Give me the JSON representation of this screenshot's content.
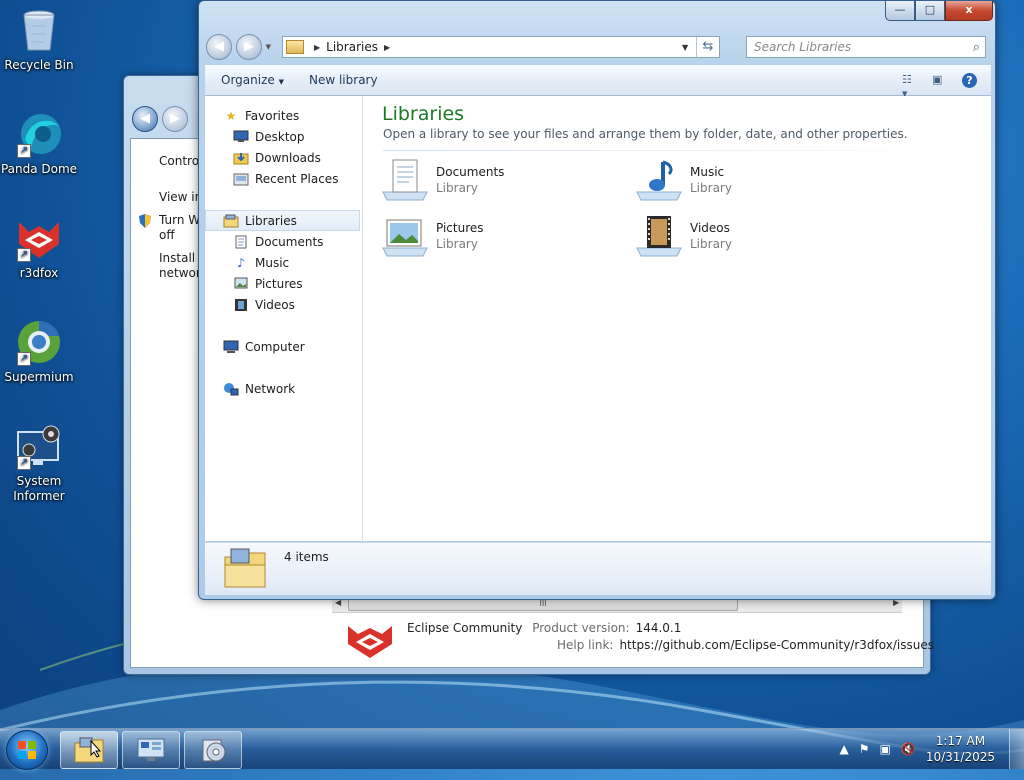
{
  "desktop": {
    "icons": [
      {
        "label": "Recycle Bin"
      },
      {
        "label": "Panda Dome"
      },
      {
        "label": "r3dfox"
      },
      {
        "label": "Supermium"
      },
      {
        "label": "System Informer"
      }
    ]
  },
  "back_window": {
    "partial_texts": [
      "Contro",
      "View in",
      "Turn W",
      "off",
      "Install a",
      "networ"
    ],
    "app_name": "Eclipse Community",
    "product_version_label": "Product version:",
    "product_version": "144.0.1",
    "help_link_label": "Help link:",
    "help_link": "https://github.com/Eclipse-Community/r3dfox/issues",
    "scroll_thumb": "III"
  },
  "explorer": {
    "caption": {
      "minimize": "—",
      "maximize": "□",
      "close": "x"
    },
    "address": {
      "path": "Libraries"
    },
    "search": {
      "placeholder": "Search Libraries"
    },
    "toolbar": {
      "organize": "Organize",
      "new_library": "New library"
    },
    "nav": {
      "favorites": "Favorites",
      "desktop": "Desktop",
      "downloads": "Downloads",
      "recent": "Recent Places",
      "libraries": "Libraries",
      "documents": "Documents",
      "music": "Music",
      "pictures": "Pictures",
      "videos": "Videos",
      "computer": "Computer",
      "network": "Network"
    },
    "content": {
      "title": "Libraries",
      "subtitle": "Open a library to see your files and arrange them by folder, date, and other properties.",
      "items": [
        {
          "name": "Documents",
          "kind": "Library"
        },
        {
          "name": "Music",
          "kind": "Library"
        },
        {
          "name": "Pictures",
          "kind": "Library"
        },
        {
          "name": "Videos",
          "kind": "Library"
        }
      ]
    },
    "details": {
      "count": "4 items"
    }
  },
  "taskbar": {
    "clock_time": "1:17 AM",
    "clock_date": "10/31/2025"
  },
  "colors": {
    "title_green": "#1e7a23",
    "close_red": "#c74b32",
    "accent_blue": "#2a66b7"
  }
}
